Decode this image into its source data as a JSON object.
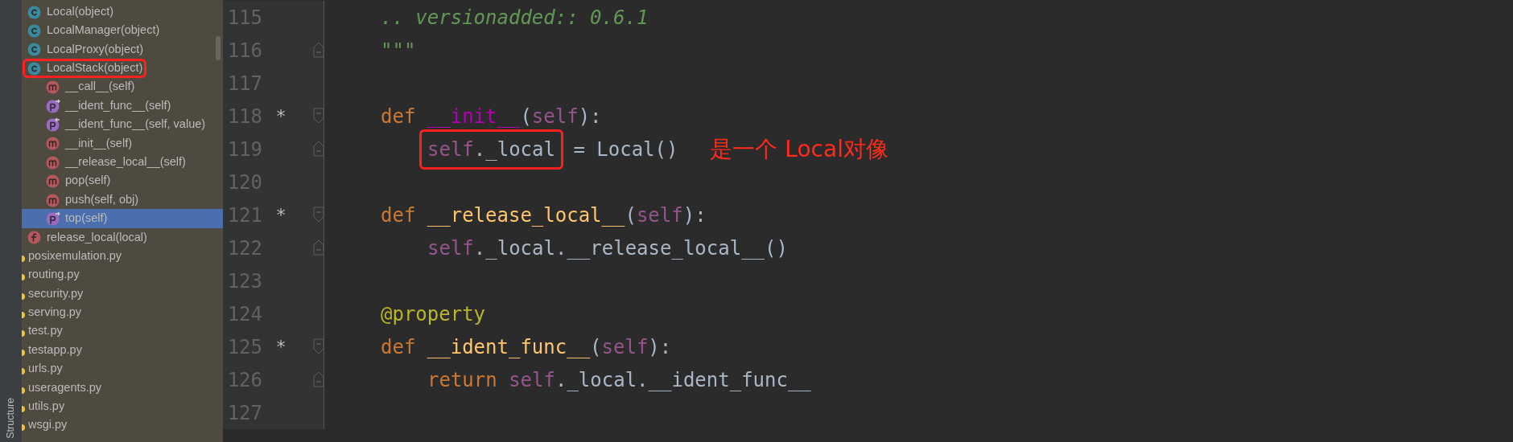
{
  "tool_window": {
    "title": "Structure"
  },
  "structure": [
    {
      "label": "Local(object)",
      "kind": "class",
      "selected": false,
      "boxed": false
    },
    {
      "label": "LocalManager(object)",
      "kind": "class",
      "selected": false,
      "boxed": false
    },
    {
      "label": "LocalProxy(object)",
      "kind": "class",
      "selected": false,
      "boxed": false
    },
    {
      "label": "LocalStack(object)",
      "kind": "class",
      "selected": false,
      "boxed": true,
      "children": [
        {
          "label": "__call__(self)",
          "kind": "method",
          "selected": false,
          "boxed": false
        },
        {
          "label": "__ident_func__(self)",
          "kind": "getter",
          "selected": false,
          "boxed": false
        },
        {
          "label": "__ident_func__(self, value)",
          "kind": "setter",
          "selected": false,
          "boxed": false
        },
        {
          "label": "__init__(self)",
          "kind": "method",
          "selected": false,
          "boxed": false
        },
        {
          "label": "__release_local__(self)",
          "kind": "method",
          "selected": false,
          "boxed": false
        },
        {
          "label": "pop(self)",
          "kind": "method",
          "selected": false,
          "boxed": false
        },
        {
          "label": "push(self, obj)",
          "kind": "method",
          "selected": false,
          "boxed": false
        },
        {
          "label": "top(self)",
          "kind": "getter",
          "selected": true,
          "boxed": false
        }
      ]
    },
    {
      "label": "release_local(local)",
      "kind": "function",
      "selected": false,
      "boxed": false
    },
    {
      "label": "posixemulation.py",
      "kind": "file",
      "selected": false,
      "boxed": false
    },
    {
      "label": "routing.py",
      "kind": "file",
      "selected": false,
      "boxed": false
    },
    {
      "label": "security.py",
      "kind": "file",
      "selected": false,
      "boxed": false
    },
    {
      "label": "serving.py",
      "kind": "file",
      "selected": false,
      "boxed": false
    },
    {
      "label": "test.py",
      "kind": "file",
      "selected": false,
      "boxed": false
    },
    {
      "label": "testapp.py",
      "kind": "file",
      "selected": false,
      "boxed": false
    },
    {
      "label": "urls.py",
      "kind": "file",
      "selected": false,
      "boxed": false
    },
    {
      "label": "useragents.py",
      "kind": "file",
      "selected": false,
      "boxed": false
    },
    {
      "label": "utils.py",
      "kind": "file",
      "selected": false,
      "boxed": false
    },
    {
      "label": "wsgi.py",
      "kind": "file",
      "selected": false,
      "boxed": false
    }
  ],
  "editor": {
    "lines": [
      {
        "number": "115",
        "kind": "member",
        "fold_start": false,
        "fold_end": false,
        "tokens": [
          {
            "kind": "docstring",
            "text": ".. versionadded:: 0.6.1"
          }
        ]
      },
      {
        "number": "116",
        "kind": "member",
        "fold_start": false,
        "fold_end": true,
        "tokens": [
          {
            "kind": "docstring",
            "text": "\"\"\""
          }
        ]
      },
      {
        "number": "117",
        "kind": "blank",
        "fold_start": false,
        "fold_end": false
      },
      {
        "number": "118",
        "kind": "member",
        "marker": "*",
        "fold_start": true,
        "fold_end": false,
        "tokens": [
          {
            "kind": "keyword",
            "text": "def"
          },
          {
            "kind": "magic",
            "text": "__init__",
            "spaced": true
          },
          {
            "kind": "plain",
            "text": "("
          },
          {
            "kind": "self",
            "text": "self"
          },
          {
            "kind": "plain",
            "text": "):"
          }
        ]
      },
      {
        "number": "119",
        "kind": "body",
        "fold_start": false,
        "fold_end": true,
        "note": "是一个 Local对像",
        "tokens": [
          {
            "kind": "self",
            "text": "self",
            "boxed": true
          },
          {
            "kind": "plain",
            "text": "._local",
            "boxed": true
          },
          {
            "kind": "plain",
            "text": "= Local()",
            "spaced": true
          }
        ]
      },
      {
        "number": "120",
        "kind": "blank",
        "fold_start": false,
        "fold_end": false
      },
      {
        "number": "121",
        "kind": "member",
        "marker": "*",
        "fold_start": true,
        "fold_end": false,
        "tokens": [
          {
            "kind": "keyword",
            "text": "def"
          },
          {
            "kind": "function",
            "text": "__release_local__",
            "spaced": true
          },
          {
            "kind": "plain",
            "text": "("
          },
          {
            "kind": "self",
            "text": "self"
          },
          {
            "kind": "plain",
            "text": "):"
          }
        ]
      },
      {
        "number": "122",
        "kind": "body",
        "fold_start": false,
        "fold_end": true,
        "tokens": [
          {
            "kind": "self",
            "text": "self"
          },
          {
            "kind": "plain",
            "text": "._local.__release_local__()"
          }
        ]
      },
      {
        "number": "123",
        "kind": "blank",
        "fold_start": false,
        "fold_end": false
      },
      {
        "number": "124",
        "kind": "member",
        "fold_start": false,
        "fold_end": false,
        "tokens": [
          {
            "kind": "decorator",
            "text": "@property"
          }
        ]
      },
      {
        "number": "125",
        "kind": "member",
        "marker": "*",
        "fold_start": true,
        "fold_end": false,
        "tokens": [
          {
            "kind": "keyword",
            "text": "def"
          },
          {
            "kind": "function",
            "text": "__ident_func__",
            "spaced": true
          },
          {
            "kind": "plain",
            "text": "("
          },
          {
            "kind": "self",
            "text": "self"
          },
          {
            "kind": "plain",
            "text": "):"
          }
        ]
      },
      {
        "number": "126",
        "kind": "body",
        "fold_start": false,
        "fold_end": true,
        "tokens": [
          {
            "kind": "keyword",
            "text": "return"
          },
          {
            "kind": "self",
            "text": "self",
            "spaced": true
          },
          {
            "kind": "plain",
            "text": "._local.__ident_func__"
          }
        ]
      },
      {
        "number": "127",
        "kind": "blank",
        "fold_start": false,
        "fold_end": false
      }
    ]
  }
}
